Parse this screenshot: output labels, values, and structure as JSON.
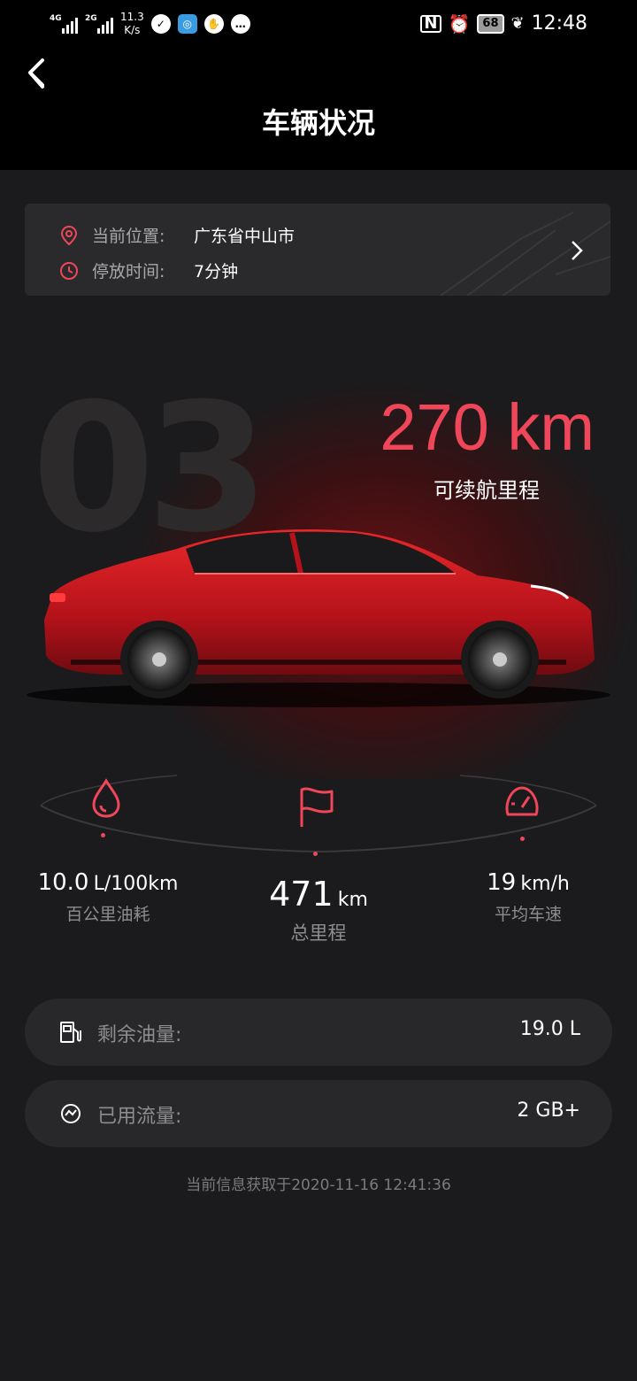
{
  "status_bar": {
    "network1": "4G",
    "network2": "2G",
    "speed_value": "11.3",
    "speed_unit": "K/s",
    "battery": "68",
    "time": "12:48"
  },
  "header": {
    "title": "车辆状况"
  },
  "location": {
    "position_label": "当前位置:",
    "position_value": "广东省中山市",
    "parked_label": "停放时间:",
    "parked_value": "7分钟"
  },
  "hero": {
    "model_number": "03",
    "range_value": "270 km",
    "range_label": "可续航里程"
  },
  "stats": {
    "fuel_consumption": {
      "value": "10.0",
      "unit": "L/100km",
      "label": "百公里油耗"
    },
    "total_mileage": {
      "value": "471",
      "unit": "km",
      "label": "总里程"
    },
    "average_speed": {
      "value": "19",
      "unit": "km/h",
      "label": "平均车速"
    }
  },
  "details": {
    "fuel_label": "剩余油量:",
    "fuel_value": "19.0 L",
    "data_label": "已用流量:",
    "data_value": "2 GB+"
  },
  "footer": {
    "timestamp_text": "当前信息获取于2020-11-16 12:41:36"
  },
  "colors": {
    "accent": "#f0465a",
    "background": "#1b1b1d",
    "card": "#2a2a2c"
  }
}
